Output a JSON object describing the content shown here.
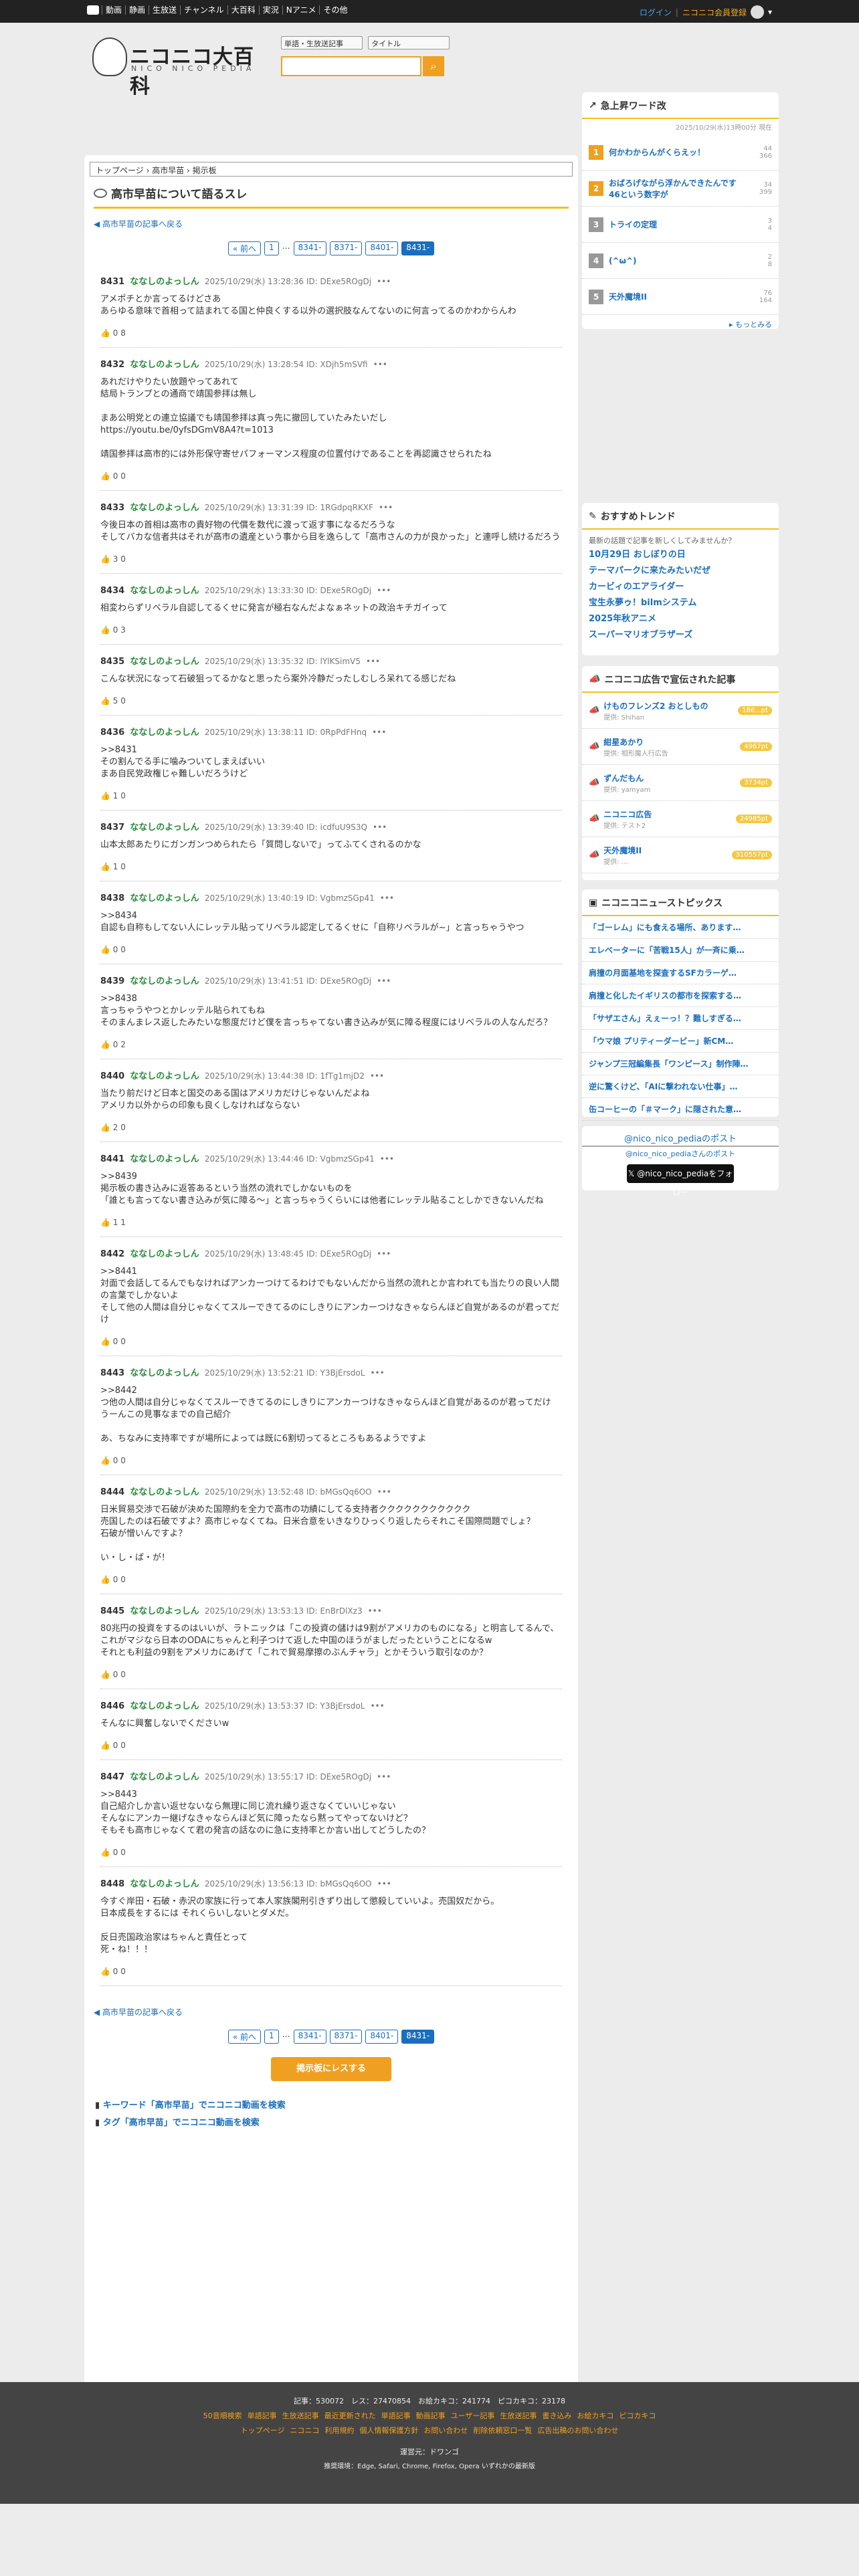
{
  "topbar": {
    "items": [
      "動画",
      "静画",
      "生放送",
      "チャンネル",
      "大百科",
      "実況",
      "Nアニメ",
      "その他"
    ],
    "login": "ログイン",
    "register": "ニコニコ会員登録"
  },
  "header": {
    "logo": "ニコニコ大百科",
    "logo_sub": "NICO NICO PEDIA",
    "select1": "単語・生放送記事",
    "select2": "タイトル"
  },
  "breadcrumb": "トップページ › 高市早苗 › 掲示板",
  "title": "高市早苗について語るスレ",
  "back": "高市早苗の記事へ戻る",
  "pager": [
    "« 前へ",
    "1",
    "…",
    "8341-",
    "8371-",
    "8401-",
    "8431-"
  ],
  "posts": [
    {
      "num": "8431",
      "name": "ななしのよっしん",
      "meta": "2025/10/29(水) 13:28:36 ID: DExe5ROgDj",
      "body": "アメポチとか言ってるけどさあ\nあらゆる意味で首相って詰まれてる国と仲良くする以外の選択肢なんてないのに何言ってるのかわからんわ",
      "foot": "0 8"
    },
    {
      "num": "8432",
      "name": "ななしのよっしん",
      "meta": "2025/10/29(水) 13:28:54 ID: XDjh5mSVfi",
      "body": "あれだけやりたい放題やってあれて\n結局トランプとの通商で靖国参拝は無し\n\nまあ公明党との連立協議でも靖国参拝は真っ先に撤回していたみたいだし\nhttps://youtu.be/0yfsDGmV8A4?t=1013\n\n靖国参拝は高市的には外形保守寄せパフォーマンス程度の位置付けであることを再認識させられたね",
      "foot": "0 0"
    },
    {
      "num": "8433",
      "name": "ななしのよっしん",
      "meta": "2025/10/29(水) 13:31:39 ID: 1RGdpqRKXF",
      "body": "今後日本の首相は高市の貴好物の代償を数代に渡って返す事になるだろうな\nそしてバカな信者共はそれが高市の遺産という事から目を逸らして「高市さんの力が良かった」と連呼し続けるだろう",
      "foot": "3 0"
    },
    {
      "num": "8434",
      "name": "ななしのよっしん",
      "meta": "2025/10/29(水) 13:33:30 ID: DExe5ROgDj",
      "body": "相変わらずリベラル自認してるくせに発言が極右なんだよなぁネットの政治キチガイって",
      "foot": "0 3"
    },
    {
      "num": "8435",
      "name": "ななしのよっしん",
      "meta": "2025/10/29(水) 13:35:32 ID: lYlKSimV5",
      "body": "こんな状況になって石破狙ってるかなと思ったら案外冷静だったしむしろ呆れてる感じだね",
      "foot": "5 0"
    },
    {
      "num": "8436",
      "name": "ななしのよっしん",
      "meta": "2025/10/29(水) 13:38:11 ID: 0RpPdFHnq",
      "body": ">>8431\nその割んでる手に噛みついてしまえばいい\nまあ自民党政権じゃ難しいだろうけど",
      "foot": "1 0"
    },
    {
      "num": "8437",
      "name": "ななしのよっしん",
      "meta": "2025/10/29(水) 13:39:40 ID: icdfuU9S3Q",
      "body": "山本太郎あたりにガンガンつめられたら「質問しないで」ってふてくされるのかな",
      "foot": "1 0"
    },
    {
      "num": "8438",
      "name": "ななしのよっしん",
      "meta": "2025/10/29(水) 13:40:19 ID: VgbmzSGp41",
      "body": ">>8434\n自認も自称もしてない人にレッテル貼ってリベラル認定してるくせに「自称リベラルが~」と言っちゃうやつ",
      "foot": "0 0"
    },
    {
      "num": "8439",
      "name": "ななしのよっしん",
      "meta": "2025/10/29(水) 13:41:51 ID: DExe5ROgDj",
      "body": ">>8438\n言っちゃうやつとかレッテル貼られてもね\nそのまんまレス返したみたいな態度だけど僕を言っちゃてない書き込みが気に障る程度にはリベラルの人なんだろ？",
      "foot": "0 2"
    },
    {
      "num": "8440",
      "name": "ななしのよっしん",
      "meta": "2025/10/29(水) 13:44:38 ID: 1fTg1mjD2",
      "body": "当たり前だけど日本と国交のある国はアメリカだけじゃないんだよね\nアメリカ以外からの印象も良くしなければならない",
      "foot": "2 0"
    },
    {
      "num": "8441",
      "name": "ななしのよっしん",
      "meta": "2025/10/29(水) 13:44:46 ID: VgbmzSGp41",
      "body": ">>8439\n掲示板の書き込みに返答あるという当然の流れでしかないものを\n「誰とも言ってない書き込みが気に障る～」と言っちゃうくらいには他者にレッテル貼ることしかできないんだね",
      "foot": "1 1"
    },
    {
      "num": "8442",
      "name": "ななしのよっしん",
      "meta": "2025/10/29(水) 13:48:45 ID: DExe5ROgDj",
      "body": ">>8441\n対面で会話してるんでもなければアンカーつけてるわけでもないんだから当然の流れとか言われても当たりの良い人間の言葉でしかないよ\nそして他の人間は自分じゃなくてスルーできてるのにしきりにアンカーつけなきゃならんほど自覚があるのが君ってだけ",
      "foot": "0 0"
    },
    {
      "num": "8443",
      "name": "ななしのよっしん",
      "meta": "2025/10/29(水) 13:52:21 ID: Y3BjErsdoL",
      "body": ">>8442\nつ他の人間は自分じゃなくてスルーできてるのにしきりにアンカーつけなきゃならんほど自覚があるのが君ってだけ\nうーんこの見事なまでの自己紹介\n\nあ、ちなみに支持率ですが場所によっては既に6割切ってるところもあるようですよ",
      "foot": "0 0"
    },
    {
      "num": "8444",
      "name": "ななしのよっしん",
      "meta": "2025/10/29(水) 13:52:48 ID: bMGsQq6OO",
      "body": "日米貿易交渉で石破が決めた国際約を全力で高市の功績にしてる支持者ククククククククククク\n売国したのは石破ですよ？高市じゃなくてね。日米合意をいきなりひっくり返したらそれこそ国際問題でしょ？\n石破が憎いんですよ？\n\nい・し・ば・が！",
      "foot": "0 0"
    },
    {
      "num": "8445",
      "name": "ななしのよっしん",
      "meta": "2025/10/29(水) 13:53:13 ID: EnBrDlXz3",
      "body": "80兆円の投資をするのはいいが、ラトニックは「この投資の儲けは9割がアメリカのものになる」と明言してるんで、これがマジなら日本のODAにちゃんと利子つけて返した中国のほうがましだったということになるw\nそれとも利益の9割をアメリカにあげて「これで貿易摩擦のぶんチャラ」とかそういう取引なのか？",
      "foot": "0 0"
    },
    {
      "num": "8446",
      "name": "ななしのよっしん",
      "meta": "2025/10/29(水) 13:53:37 ID: Y3BjErsdoL",
      "body": "そんなに興奮しないでくださいw",
      "foot": "0 0"
    },
    {
      "num": "8447",
      "name": "ななしのよっしん",
      "meta": "2025/10/29(水) 13:55:17 ID: DExe5ROgDj",
      "body": ">>8443\n自己紹介しか言い返せないなら無理に同じ流れ繰り返さなくていいじゃない\nそんなにアンカー継げなきゃならんほど気に障ったなら黙ってやってないけど？\nそもそも高市じゃなくて君の発言の話なのに急に支持率とか言い出してどうしたの？",
      "foot": "0 0"
    },
    {
      "num": "8448",
      "name": "ななしのよっしん",
      "meta": "2025/10/29(水) 13:56:13 ID: bMGsQq6OO",
      "body": "今すぐ岸田・石破・赤沢の家族に行って本人家族閣刑引きずり出して懲殺していいよ。売国奴だから。\n日本成長をするには それくらいしないとダメだ。\n\n反日売国政治家はちゃんと責任とって\n死・ね！！！",
      "foot": "0 0"
    }
  ],
  "show_button": "掲示板にレスする",
  "search_links": [
    "キーワード「高市早苗」でニコニコ動画を検索",
    "タグ「高市早苗」でニコニコ動画を検索"
  ],
  "side_ranking": {
    "title": "急上昇ワード改",
    "date": "2025/10/29(水)13時00分 現在",
    "items": [
      {
        "rank": "1",
        "text": "何かわからんがくらえッ！",
        "c1": "44",
        "c2": "366"
      },
      {
        "rank": "2",
        "text": "おばろげながら浮かんできたんです　46という数字が",
        "c1": "34",
        "c2": "399"
      },
      {
        "rank": "3",
        "text": "トライの定理",
        "c1": "3",
        "c2": "4"
      },
      {
        "rank": "4",
        "text": "(^ω^)",
        "c1": "2",
        "c2": "8"
      },
      {
        "rank": "5",
        "text": "天外魔境II",
        "c1": "76",
        "c2": "164"
      }
    ],
    "more": "もっとみる"
  },
  "side_trend": {
    "title": "おすすめトレンド",
    "note": "最新の話題で記事を新しくしてみませんか？",
    "items": [
      "10月29日 おしぼりの日",
      "テーマパークに来たみたいだぜ",
      "カービィのエアライダー",
      "宝生永夢ゥ！bilmシステム",
      "2025年秋アニメ",
      "スーパーマリオブラザーズ"
    ]
  },
  "side_ads": {
    "title": "ニコニコ広告で宣伝された記事",
    "items": [
      {
        "t": "けものフレンズ2 おとしもの",
        "s": "提供: Shihan",
        "p": "186...pt"
      },
      {
        "t": "紺星あかり",
        "s": "提供: 相形魔人行広告",
        "p": "4967pt"
      },
      {
        "t": "ずんだもん",
        "s": "提供: yamyam",
        "p": "3734pt"
      },
      {
        "t": "ニコニコ広告",
        "s": "提供: テスト2",
        "p": "24985pt"
      },
      {
        "t": "天外魔境II",
        "s": "提供: ...",
        "p": "310557pt"
      }
    ]
  },
  "side_news": {
    "title": "ニコニコニューストピックス",
    "items": [
      "「ゴーレム」にも食える場所、あります…",
      "エレベーターに「苦戦15人」が一斉に乗…",
      "肩撞の月面基地を探査するSFカラーゲ…",
      "肩撞と化したイギリスの都市を探索する…",
      "「サザエさん」えぇーっ！？難しすぎる…",
      "「ウマ娘 プリティーダービー」新CM…",
      "ジャンプ三冠編集長「ワンピース」制作陣…",
      "逆に驚くけど、「AIに撃われない仕事」…",
      "缶コーヒーの「＃マーク」に隠された意…"
    ]
  },
  "side_x": {
    "handle": "@nico_nico_pediaのポスト",
    "sub": "@nico_nico_pediaさんのポスト",
    "btn": "@nico_nico_pediaをフォロー"
  },
  "footer": {
    "stats": "記事：530072　レス：27470854　お絵カキコ：241774　ピコカキコ：23178",
    "links1": [
      "50音順検索",
      "単語記事",
      "生放送記事",
      "最近更新された",
      "単語記事",
      "動画記事",
      "ユーザー記事",
      "生放送記事",
      "書き込み",
      "お絵カキコ",
      "ピコカキコ"
    ],
    "links2": [
      "トップページ",
      "ニコニコ",
      "利用規約",
      "個人情報保護方針",
      "お問い合わせ",
      "削除依頼窓口一覧",
      "広告出稿のお問い合わせ"
    ],
    "op": "運営元：ドワンゴ",
    "env": "推奨環境：Edge, Safari, Chrome, Firefox, Opera いずれかの最新版"
  }
}
